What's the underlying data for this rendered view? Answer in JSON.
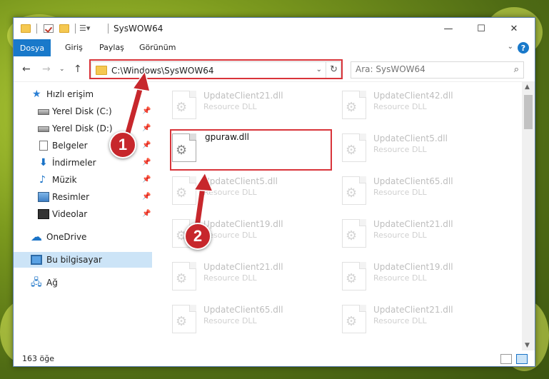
{
  "window": {
    "title": "SysWOW64",
    "minimize": "—",
    "maximize": "☐",
    "close": "✕"
  },
  "ribbon": {
    "tabs": [
      "Dosya",
      "Giriş",
      "Paylaş",
      "Görünüm"
    ],
    "help": "?"
  },
  "address": {
    "path": "C:\\Windows\\SysWOW64"
  },
  "search": {
    "placeholder": "Ara: SysWOW64"
  },
  "sidebar": {
    "items": [
      {
        "label": "Hızlı erişim",
        "icon": "star-icon"
      },
      {
        "label": "Yerel Disk (C:)",
        "icon": "drive-icon"
      },
      {
        "label": "Yerel Disk (D:)",
        "icon": "drive-icon"
      },
      {
        "label": "Belgeler",
        "icon": "document-icon"
      },
      {
        "label": "İndirmeler",
        "icon": "download-icon"
      },
      {
        "label": "Müzik",
        "icon": "music-icon"
      },
      {
        "label": "Resimler",
        "icon": "pictures-icon"
      },
      {
        "label": "Videolar",
        "icon": "videos-icon"
      },
      {
        "label": "OneDrive",
        "icon": "cloud-icon"
      },
      {
        "label": "Bu bilgisayar",
        "icon": "computer-icon"
      },
      {
        "label": "Ağ",
        "icon": "network-icon"
      }
    ]
  },
  "files": {
    "left": [
      {
        "name": "UpdateClient21.dll",
        "type": "Resource DLL"
      },
      {
        "name": "gpuraw.dll",
        "type": ""
      },
      {
        "name": "UpdateClient5.dll",
        "type": "Resource DLL"
      },
      {
        "name": "UpdateClient19.dll",
        "type": "Resource DLL"
      },
      {
        "name": "UpdateClient21.dll",
        "type": "Resource DLL"
      },
      {
        "name": "UpdateClient65.dll",
        "type": "Resource DLL"
      }
    ],
    "right": [
      {
        "name": "UpdateClient42.dll",
        "type": "Resource DLL"
      },
      {
        "name": "UpdateClient5.dll",
        "type": "Resource DLL"
      },
      {
        "name": "UpdateClient65.dll",
        "type": "Resource DLL"
      },
      {
        "name": "UpdateClient21.dll",
        "type": "Resource DLL"
      },
      {
        "name": "UpdateClient19.dll",
        "type": "Resource DLL"
      },
      {
        "name": "UpdateClient21.dll",
        "type": "Resource DLL"
      }
    ]
  },
  "status": {
    "count": "163 öğe"
  },
  "markers": {
    "step1": "1",
    "step2": "2"
  },
  "colors": {
    "accent": "#1979ca",
    "highlight_red": "#d9343a",
    "marker_red": "#c7272c"
  }
}
